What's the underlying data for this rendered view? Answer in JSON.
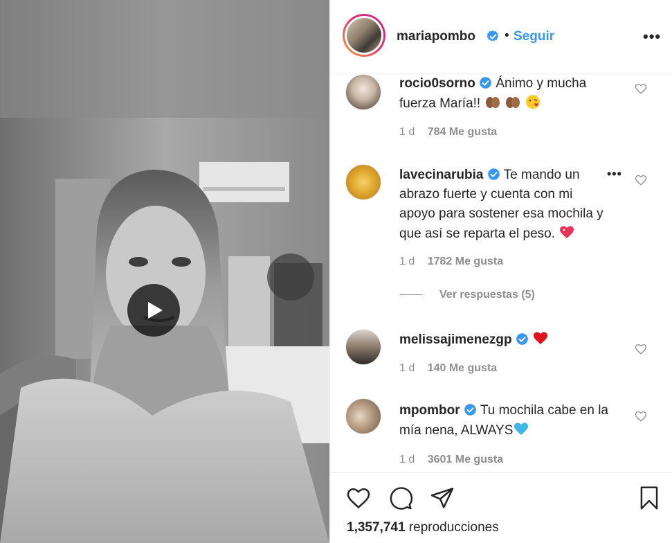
{
  "post": {
    "username": "mariapombo",
    "dot": "•",
    "follow_label": "Seguir",
    "more_label": "•••"
  },
  "comments": [
    {
      "username": "rocio0sorno",
      "text": "Ánimo y mucha fuerza María!!",
      "emojis": [
        "hands-brown-icon",
        "hands-brown-icon",
        "kiss-face-icon"
      ],
      "time": "1 d",
      "likes": "784 Me gusta"
    },
    {
      "username": "lavecinarubia",
      "text": "Te mando un abrazo fuerte y cuenta con mi apoyo para sostener esa mochila y que así se reparta el peso.",
      "emojis": [
        "sparkle-heart-icon"
      ],
      "time": "1 d",
      "likes": "1782 Me gusta",
      "more_label": "•••"
    },
    {
      "username": "melissajimenezgp",
      "text": "",
      "emojis": [
        "red-heart-icon"
      ],
      "time": "1 d",
      "likes": "140 Me gusta"
    },
    {
      "username": "mpombor",
      "text": "Tu mochila cabe en la mía nena, ALWAYS",
      "emojis": [
        "blue-heart-icon"
      ],
      "time": "1 d",
      "likes": "3601 Me gusta"
    }
  ],
  "view_replies": "Ver respuestas (5)",
  "stats": {
    "views_number": "1,357,741",
    "views_label": "reproducciones"
  },
  "colors": {
    "link": "#3897f0",
    "verified": "#3897f0",
    "muted": "#8e8e8e",
    "text": "#262626"
  }
}
